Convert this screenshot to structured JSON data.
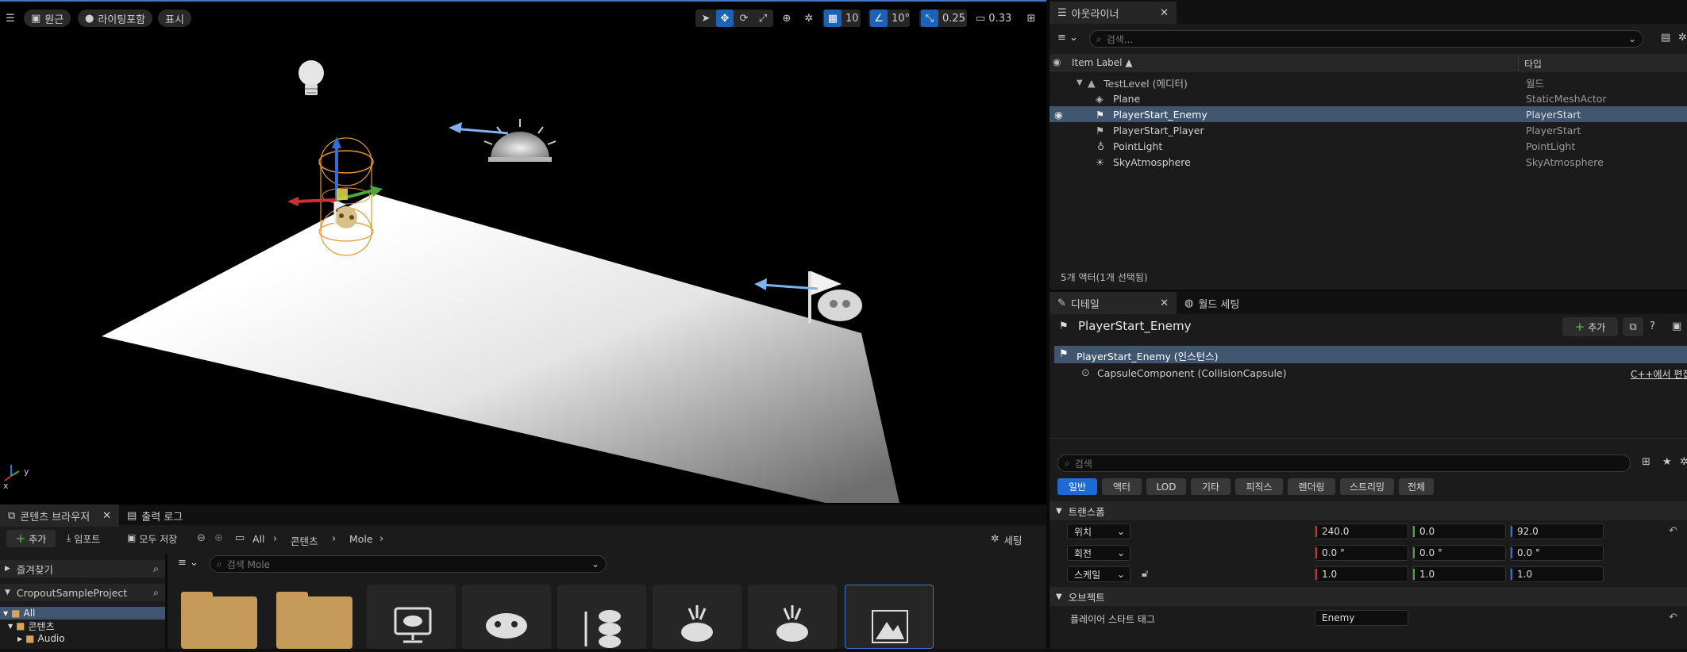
{
  "viewport": {
    "toolbar": {
      "perspective_label": "원근",
      "lighting_label": "라이팅포함",
      "show_label": "표시",
      "grid_snap_value": "10",
      "rotation_snap_value": "10°",
      "scale_snap_value": "0.25",
      "camera_speed_value": "0.33"
    }
  },
  "outliner": {
    "tab_title": "아웃라이너",
    "search_placeholder": "검색...",
    "col_label": "Item Label ▲",
    "col_type": "타입",
    "root": {
      "label": "TestLevel (에디터)",
      "type": "월드"
    },
    "items": [
      {
        "label": "Plane",
        "type": "StaticMeshActor",
        "icon": "static-mesh-icon",
        "selected": false
      },
      {
        "label": "PlayerStart_Enemy",
        "type": "PlayerStart",
        "icon": "player-start-icon",
        "selected": true
      },
      {
        "label": "PlayerStart_Player",
        "type": "PlayerStart",
        "icon": "player-start-icon",
        "selected": false
      },
      {
        "label": "PointLight",
        "type": "PointLight",
        "icon": "light-bulb-icon",
        "selected": false
      },
      {
        "label": "SkyAtmosphere",
        "type": "SkyAtmosphere",
        "icon": "sky-icon",
        "selected": false
      }
    ],
    "status": "5개 액터(1개 선택됨)"
  },
  "details": {
    "tab_details": "디테일",
    "tab_world": "월드 세팅",
    "actor_name": "PlayerStart_Enemy",
    "add_label": "추가",
    "instance_label": "PlayerStart_Enemy (인스턴스)",
    "component_label": "CapsuleComponent (CollisionCapsule)",
    "cpp_edit_label": "C++에서 편집",
    "search_placeholder": "검색",
    "categories": [
      "일반",
      "액터",
      "LOD",
      "기타",
      "피직스",
      "렌더링",
      "스트리밍",
      "전체"
    ],
    "transform_header": "트랜스폼",
    "location_label": "위치",
    "rotation_label": "회전",
    "scale_label": "스케일",
    "location": [
      "240.0",
      "0.0",
      "92.0"
    ],
    "rotation": [
      "0.0 °",
      "0.0 °",
      "0.0 °"
    ],
    "scale": [
      "1.0",
      "1.0",
      "1.0"
    ],
    "object_header": "오브젝트",
    "player_start_tag_label": "플레이어 스타트 태그",
    "player_start_tag_value": "Enemy",
    "colors": {
      "x_axis": "#c8312e",
      "y_axis": "#4aa83d",
      "z_axis": "#2f6fd6",
      "accent": "#1e6ad4",
      "selection": "#3f5570"
    }
  },
  "content_browser": {
    "tab_content": "콘텐츠 브라우저",
    "tab_output": "출력 로그",
    "add_label": "추가",
    "import_label": "임포트",
    "save_all_label": "모두 저장",
    "breadcrumb": [
      "All",
      "콘텐츠",
      "Mole"
    ],
    "settings_label": "세팅",
    "favorites_label": "즐겨찾기",
    "project_label": "CropoutSampleProject",
    "search_placeholder": "검색 Mole",
    "tree": [
      "All",
      "콘텐츠",
      "Audio"
    ]
  }
}
